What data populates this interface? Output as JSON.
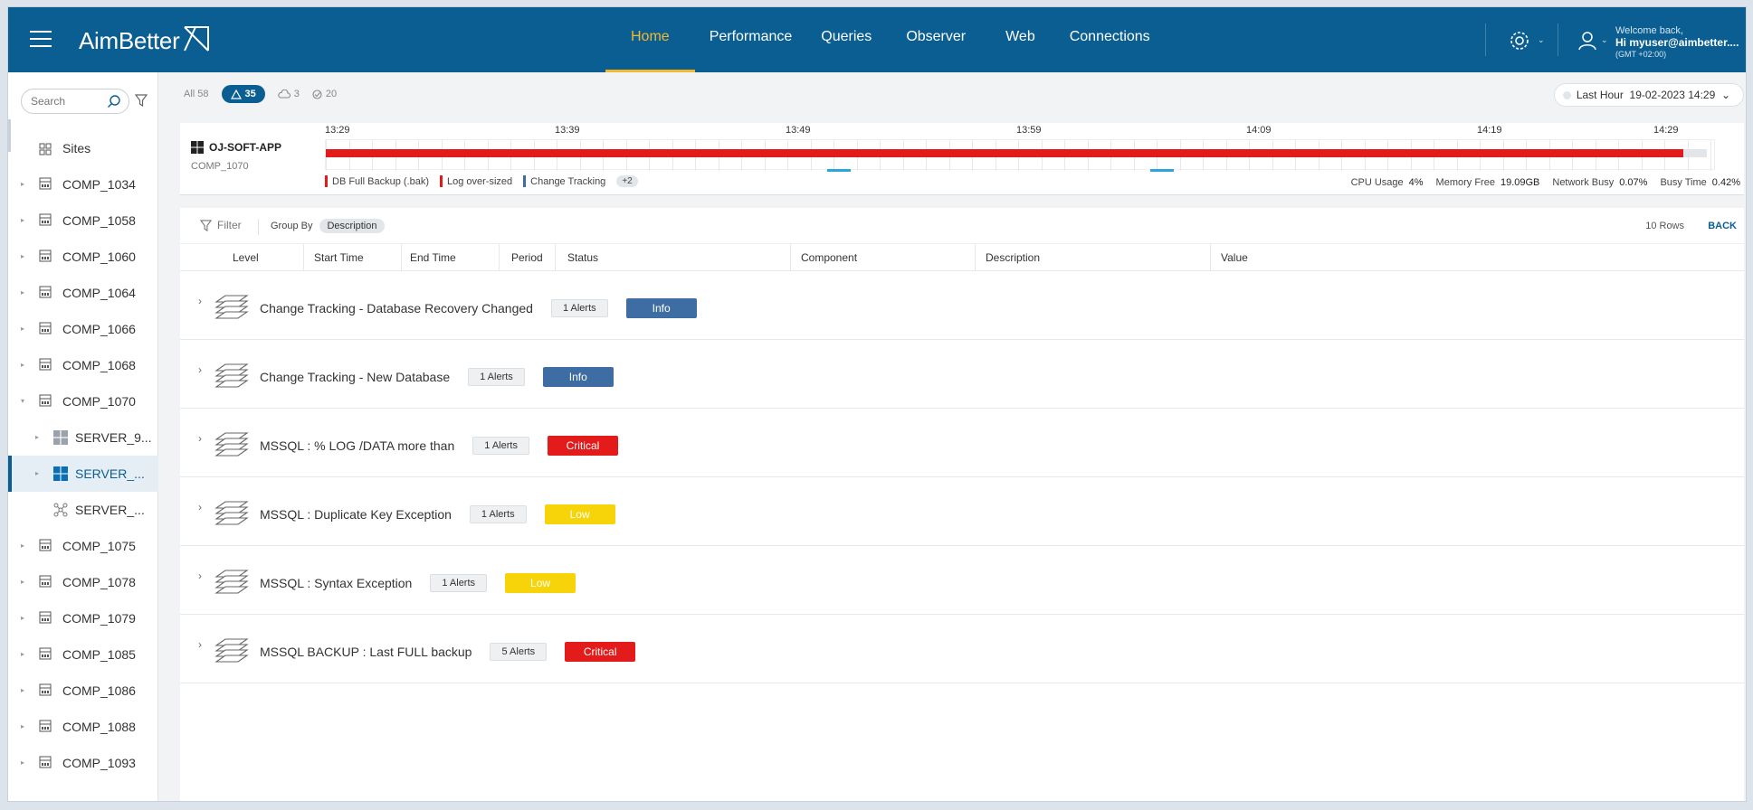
{
  "header": {
    "logo": "AimBetter",
    "nav": [
      "Home",
      "Performance",
      "Queries",
      "Observer",
      "Web",
      "Connections"
    ],
    "active_nav": "Home",
    "welcome": "Welcome back,",
    "user": "Hi myuser@aimbetter....",
    "timezone": "(GMT +02:00)"
  },
  "sidebar": {
    "search_placeholder": "Search",
    "sites_label": "Sites",
    "items": [
      {
        "label": "COMP_1034"
      },
      {
        "label": "COMP_1058"
      },
      {
        "label": "COMP_1060"
      },
      {
        "label": "COMP_1064"
      },
      {
        "label": "COMP_1066"
      },
      {
        "label": "COMP_1068"
      },
      {
        "label": "COMP_1070"
      },
      {
        "label": "SERVER_9..."
      },
      {
        "label": "SERVER_..."
      },
      {
        "label": "SERVER_..."
      },
      {
        "label": "COMP_1075"
      },
      {
        "label": "COMP_1078"
      },
      {
        "label": "COMP_1079"
      },
      {
        "label": "COMP_1085"
      },
      {
        "label": "COMP_1086"
      },
      {
        "label": "COMP_1088"
      },
      {
        "label": "COMP_1093"
      }
    ]
  },
  "counts": {
    "all": "All 58",
    "alerts": "35",
    "cloud": "3",
    "checked": "20"
  },
  "time_selector": {
    "range": "Last Hour",
    "date": "19-02-2023 14:29"
  },
  "server": {
    "name": "OJ-SOFT-APP",
    "comp": "COMP_1070",
    "ticks": [
      "13:29",
      "13:39",
      "13:49",
      "13:59",
      "14:09",
      "14:19",
      "14:29"
    ],
    "legend": [
      {
        "label": "DB Full Backup (.bak)",
        "color": "#e31b1b"
      },
      {
        "label": "Log over-sized",
        "color": "#e31b1b"
      },
      {
        "label": "Change Tracking",
        "color": "#3d6da3"
      }
    ],
    "legend_more": "+2",
    "metrics": [
      {
        "label": "CPU Usage",
        "value": "4%"
      },
      {
        "label": "Memory Free",
        "value": "19.09GB"
      },
      {
        "label": "Network Busy",
        "value": "0.07%"
      },
      {
        "label": "Busy Time",
        "value": "0.42%"
      }
    ]
  },
  "table": {
    "filter_label": "Filter",
    "group_by_label": "Group By",
    "group_by_value": "Description",
    "rows_count": "10 Rows",
    "back_label": "BACK",
    "columns": [
      "Level",
      "Start Time",
      "End Time",
      "Period",
      "Status",
      "Component",
      "Description",
      "Value"
    ],
    "groups": [
      {
        "title": "Change Tracking - Database Recovery Changed",
        "alerts": "1 Alerts",
        "severity": "Info",
        "color": "#3d6da3",
        "text_color": "#ffffff"
      },
      {
        "title": "Change Tracking - New Database",
        "alerts": "1 Alerts",
        "severity": "Info",
        "color": "#3d6da3",
        "text_color": "#ffffff"
      },
      {
        "title": "MSSQL : % LOG /DATA more than",
        "alerts": "1 Alerts",
        "severity": "Critical",
        "color": "#e31b1b",
        "text_color": "#ffffff"
      },
      {
        "title": "MSSQL : Duplicate Key Exception",
        "alerts": "1 Alerts",
        "severity": "Low",
        "color": "#f7d40a",
        "text_color": "#ffffff"
      },
      {
        "title": "MSSQL : Syntax Exception",
        "alerts": "1 Alerts",
        "severity": "Low",
        "color": "#f7d40a",
        "text_color": "#ffffff"
      },
      {
        "title": "MSSQL BACKUP : Last FULL backup",
        "alerts": "5 Alerts",
        "severity": "Critical",
        "color": "#e31b1b",
        "text_color": "#ffffff"
      }
    ]
  }
}
